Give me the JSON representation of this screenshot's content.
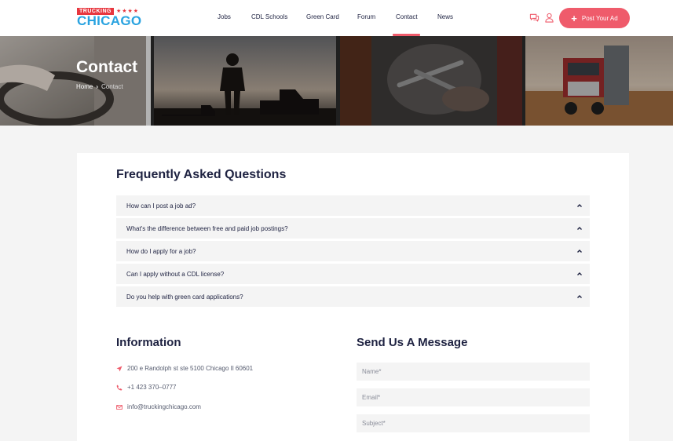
{
  "logo": {
    "top_text": "TRUCKING",
    "stars": "★★★★",
    "main_text": "CHICAGO"
  },
  "nav": {
    "items": [
      "Jobs",
      "CDL Schools",
      "Green Card",
      "Forum",
      "Contact",
      "News"
    ],
    "active": "Contact"
  },
  "header": {
    "post_button_label": "Post Your Ad",
    "icons": [
      "chat-icon",
      "user-icon"
    ]
  },
  "hero": {
    "title": "Contact",
    "breadcrumb": {
      "home": "Home",
      "separator": "›",
      "current": "Contact"
    }
  },
  "faq": {
    "title": "Frequently Asked Questions",
    "items": [
      "How can I post a job ad?",
      "What's the difference between free and paid job postings?",
      "How do I apply for a job?",
      "Can I apply without a CDL license?",
      "Do you help with green card applications?"
    ]
  },
  "information": {
    "title": "Information",
    "address": "200 e Randolph st ste 5100 Chicago Il 60601",
    "phone": "+1 423 370–0777",
    "email": "info@truckingchicago.com"
  },
  "message_form": {
    "title": "Send Us A Message",
    "name_placeholder": "Name*",
    "email_placeholder": "Email*",
    "subject_placeholder": "Subject*"
  },
  "colors": {
    "accent": "#ef5b6b",
    "brand_blue": "#2aa3e0",
    "heading": "#1e2241"
  }
}
